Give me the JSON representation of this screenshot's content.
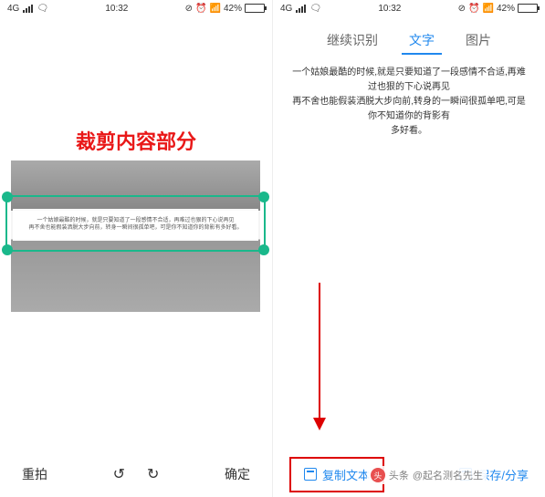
{
  "statusBar": {
    "network": "4G",
    "time": "10:32",
    "battery": "42%",
    "wifi": "⬡"
  },
  "leftPanel": {
    "title": "裁剪内容部分",
    "cropTextLine1": "一个姑娘最酷的时候，就是只要知道了一段感情不合适，再难过也狠的下心说再见",
    "cropTextLine2": "再不舍也能假装洒脱大步向前，转身一瞬间很孤单吧，可是你不知道你的背影有多好看。",
    "bottomBar": {
      "retake": "重拍",
      "confirm": "确定"
    }
  },
  "rightPanel": {
    "tabs": {
      "continue": "继续识别",
      "text": "文字",
      "image": "图片"
    },
    "resultText": {
      "line1": "一个姑娘最酷的时候,就是只要知道了一段感情不合适,再难过也狠的下心说再见",
      "line2": "再不舍也能假装洒脱大步向前,转身的一瞬间很孤单吧,可是你不知道你的背影有",
      "line3": "多好看。"
    },
    "bottomBar": {
      "copy": "复制文本",
      "save": "保存/分享"
    }
  },
  "watermark": {
    "prefix": "头条",
    "author": "@起名测名先生"
  }
}
